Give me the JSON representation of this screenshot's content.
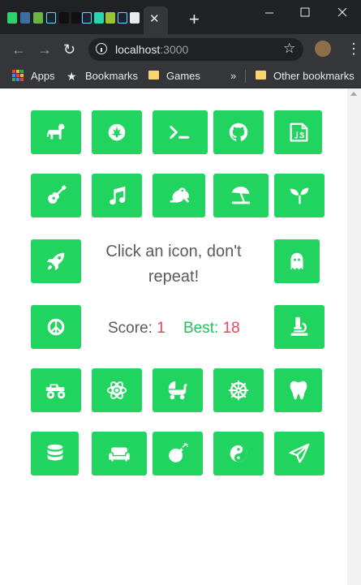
{
  "browser": {
    "url_host": "localhost",
    "url_port": ":3000",
    "bookmarks": {
      "apps": "Apps",
      "bookmarks": "Bookmarks",
      "games": "Games",
      "overflow": "»",
      "other": "Other bookmarks"
    },
    "colors": {
      "frame": "#202124",
      "toolbar": "#35363a",
      "text": "#e8eaed"
    }
  },
  "game": {
    "message": "Click an icon, don't repeat!",
    "score_label": "Score:",
    "score_value": "1",
    "best_label": "Best:",
    "best_value": "18",
    "accent_color": "#21d35f",
    "icons": [
      "horse-icon",
      "rebel-alliance-icon",
      "terminal-icon",
      "github-icon",
      "js-icon",
      "guitar-icon",
      "music-icon",
      "frog-icon",
      "umbrella-beach-icon",
      "seedling-icon",
      "rocket-icon",
      "ghost-icon",
      "peace-icon",
      "microscope-icon",
      "monster-truck-icon",
      "atom-icon",
      "baby-carriage-icon",
      "dharmachakra-icon",
      "tooth-icon",
      "database-icon",
      "couch-icon",
      "bomb-icon",
      "yin-yang-icon",
      "paper-plane-icon"
    ]
  }
}
